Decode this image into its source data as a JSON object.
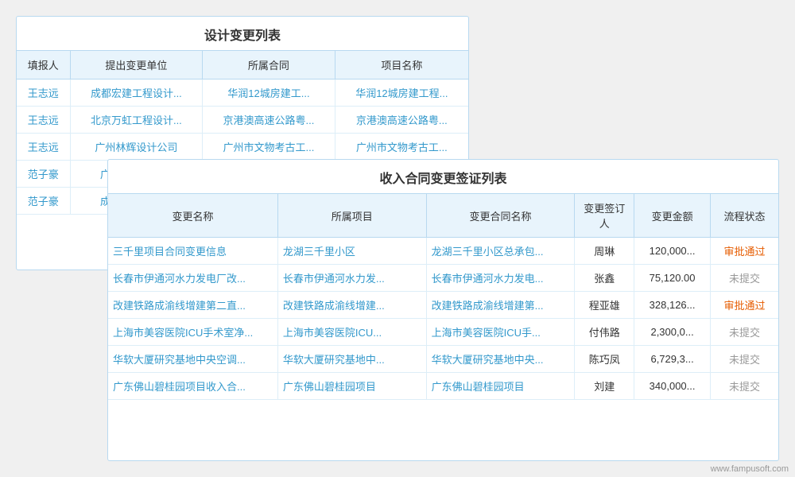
{
  "designPanel": {
    "title": "设计变更列表",
    "columns": [
      "填报人",
      "提出变更单位",
      "所属合同",
      "项目名称"
    ],
    "rows": [
      {
        "reporter": "王志远",
        "unit": "成都宏建工程设计...",
        "contract": "华润12城房建工...",
        "project": "华润12城房建工程..."
      },
      {
        "reporter": "王志远",
        "unit": "北京万虹工程设计...",
        "contract": "京港澳高速公路粤...",
        "project": "京港澳高速公路粤..."
      },
      {
        "reporter": "王志远",
        "unit": "广州林辉设计公司",
        "contract": "广州市文物考古工...",
        "project": "广州市文物考古工..."
      },
      {
        "reporter": "范子豪",
        "unit": "广东鸿达鑫工程",
        "contract": "",
        "project": ""
      },
      {
        "reporter": "范子豪",
        "unit": "成都浩海工程设",
        "contract": "",
        "project": ""
      }
    ]
  },
  "incomePanel": {
    "title": "收入合同变更签证列表",
    "columns": [
      "变更名称",
      "所属项目",
      "变更合同名称",
      "变更签订人",
      "变更金额",
      "流程状态"
    ],
    "rows": [
      {
        "name": "三千里项目合同变更信息",
        "project": "龙湖三千里小区",
        "contract": "龙湖三千里小区总承包...",
        "signer": "周琳",
        "amount": "120,000...",
        "status": "审批通过",
        "statusClass": "status-approved"
      },
      {
        "name": "长春市伊通河水力发电厂改...",
        "project": "长春市伊通河水力发...",
        "contract": "长春市伊通河水力发电...",
        "signer": "张鑫",
        "amount": "75,120.00",
        "status": "未提交",
        "statusClass": "status-pending"
      },
      {
        "name": "改建铁路成渝线增建第二直...",
        "project": "改建铁路成渝线增建...",
        "contract": "改建铁路成渝线增建第...",
        "signer": "程亚雄",
        "amount": "328,126...",
        "status": "审批通过",
        "statusClass": "status-approved"
      },
      {
        "name": "上海市美容医院ICU手术室净...",
        "project": "上海市美容医院ICU...",
        "contract": "上海市美容医院ICU手...",
        "signer": "付伟路",
        "amount": "2,300,0...",
        "status": "未提交",
        "statusClass": "status-pending"
      },
      {
        "name": "华软大厦研究基地中央空调...",
        "project": "华软大厦研究基地中...",
        "contract": "华软大厦研究基地中央...",
        "signer": "陈巧凤",
        "amount": "6,729,3...",
        "status": "未提交",
        "statusClass": "status-pending"
      },
      {
        "name": "广东佛山碧桂园项目收入合...",
        "project": "广东佛山碧桂园项目",
        "contract": "广东佛山碧桂园项目",
        "signer": "刘建",
        "amount": "340,000...",
        "status": "未提交",
        "statusClass": "status-pending"
      }
    ]
  },
  "watermark": "www.fampusoft.com"
}
